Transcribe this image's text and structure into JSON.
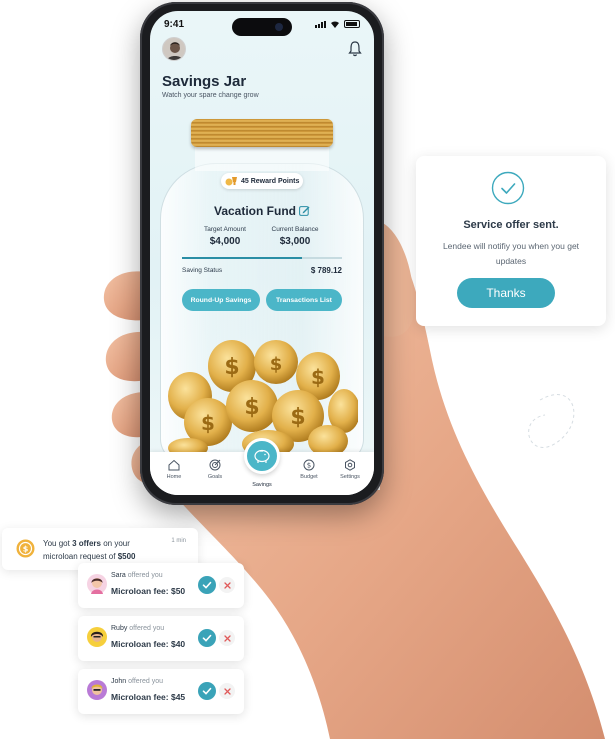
{
  "status_bar": {
    "time": "9:41"
  },
  "app": {
    "title": "Savings Jar",
    "subtitle": "Watch your spare change grow",
    "reward_points": "45 Reward Points",
    "fund_title": "Vacation Fund",
    "target_label": "Target Amount",
    "target_value": "$4,000",
    "balance_label": "Current Balance",
    "balance_value": "$3,000",
    "progress_fraction": 0.75,
    "saving_status_label": "Saving Status",
    "saving_status_value": "$ 789.12",
    "round_up_button": "Round-Up Savings",
    "transactions_button": "Transactions List"
  },
  "nav": {
    "items": [
      {
        "label": "Home",
        "icon": "home-icon"
      },
      {
        "label": "Goals",
        "icon": "target-icon"
      },
      {
        "label": "Savings",
        "icon": "piggy-bank-icon"
      },
      {
        "label": "Budget",
        "icon": "dollar-circle-icon"
      },
      {
        "label": "Settings",
        "icon": "gear-icon"
      }
    ],
    "active": "Savings"
  },
  "service_card": {
    "title": "Service offer sent.",
    "body": "Lendee will notifiy you when you get updates",
    "button": "Thanks"
  },
  "offer_banner": {
    "text_pre": "You got ",
    "text_bold": "3 offers",
    "text_mid": " on your microloan request of ",
    "amount": "$500",
    "time": "1 min"
  },
  "offers": [
    {
      "name": "Sara",
      "suffix": " offered you",
      "fee": "Microloan fee: $50"
    },
    {
      "name": "Ruby",
      "suffix": " offered you",
      "fee": "Microloan fee: $40"
    },
    {
      "name": "John",
      "suffix": " offered you",
      "fee": "Microloan fee: $45"
    }
  ],
  "colors": {
    "accent": "#4bb6c8",
    "accent_dark": "#3aa3b8",
    "text_dark": "#1e2a3a",
    "gold": "#e2b04a"
  }
}
